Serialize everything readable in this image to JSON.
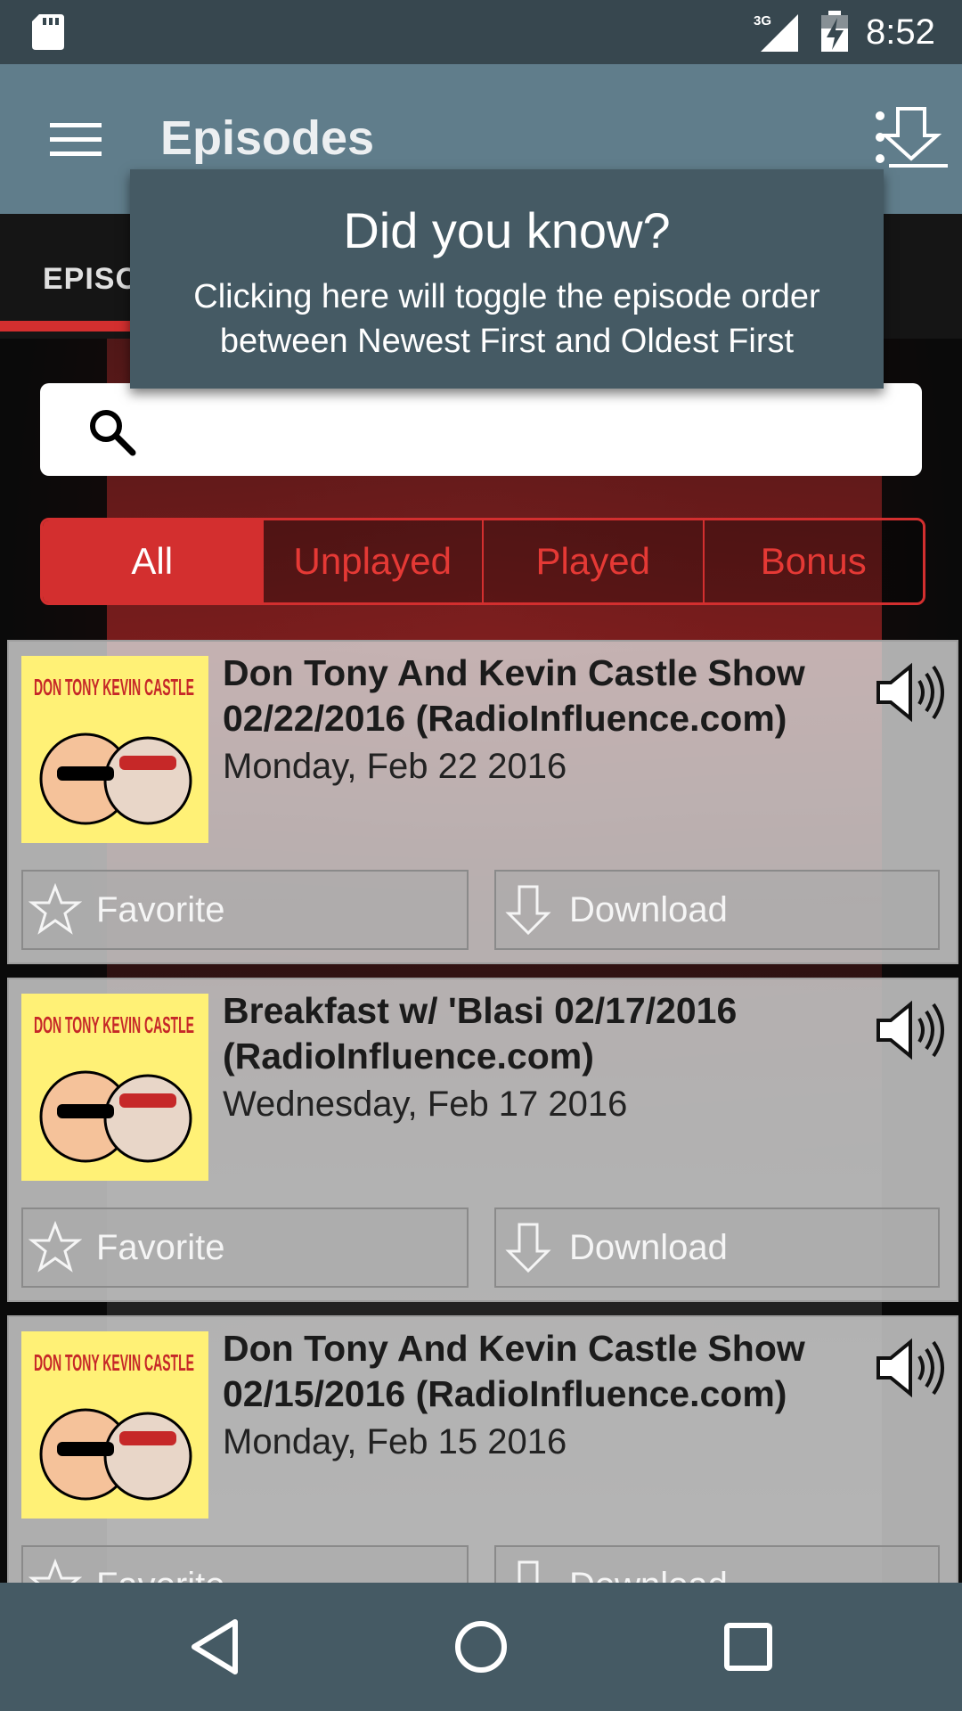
{
  "status_bar": {
    "time": "8:52",
    "network": "3G"
  },
  "app_bar": {
    "title": "Episodes"
  },
  "tabs": [
    {
      "label": "EPISO"
    }
  ],
  "tooltip": {
    "title": "Did you know?",
    "body": "Clicking here will toggle the episode order between Newest First and Oldest First"
  },
  "search": {
    "placeholder": ""
  },
  "filters": [
    {
      "label": "All",
      "active": true
    },
    {
      "label": "Unplayed",
      "active": false
    },
    {
      "label": "Played",
      "active": false
    },
    {
      "label": "Bonus",
      "active": false
    }
  ],
  "episodes": [
    {
      "title": "Don Tony And Kevin Castle Show 02/22/2016 (RadioInfluence.com)",
      "date": "Monday, Feb 22 2016",
      "favorite_label": "Favorite",
      "download_label": "Download"
    },
    {
      "title": "Breakfast w/ 'Blasi 02/17/2016 (RadioInfluence.com)",
      "date": "Wednesday, Feb 17 2016",
      "favorite_label": "Favorite",
      "download_label": "Download"
    },
    {
      "title": "Don Tony And Kevin Castle Show 02/15/2016 (RadioInfluence.com)",
      "date": "Monday, Feb 15 2016",
      "favorite_label": "Favorite",
      "download_label": "Download"
    }
  ],
  "thumbnail": {
    "logo_text": "DON TONY KEVIN CASTLE"
  },
  "colors": {
    "accent": "#d32f2f",
    "app_bar": "#607d8b",
    "status_bar": "#37474f",
    "tooltip": "#455a64"
  }
}
